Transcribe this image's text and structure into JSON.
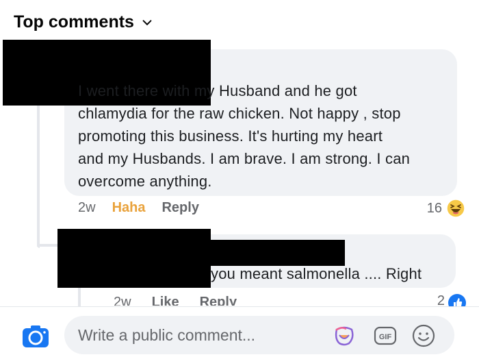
{
  "header": {
    "title": "Top comments"
  },
  "comment1": {
    "text": "I went there with my Husband and he got\nchlamydia for the raw chicken. Not happy , stop\npromoting this business. It's hurting my heart\nand my Husbands. I am brave. I am strong. I can\novercome anything.",
    "time": "2w",
    "reaction_label": "Haha",
    "reply_label": "Reply",
    "reaction_count": "16"
  },
  "comment2": {
    "text": "you meant salmonella .... Right",
    "time": "2w",
    "like_label": "Like",
    "reply_label": "Reply",
    "reaction_count": "2"
  },
  "composer": {
    "placeholder": "Write a public comment...",
    "gif_label": "GIF"
  },
  "colors": {
    "haha": "#e9a23b",
    "bubble": "#f0f2f5",
    "accent": "#1877f2"
  }
}
